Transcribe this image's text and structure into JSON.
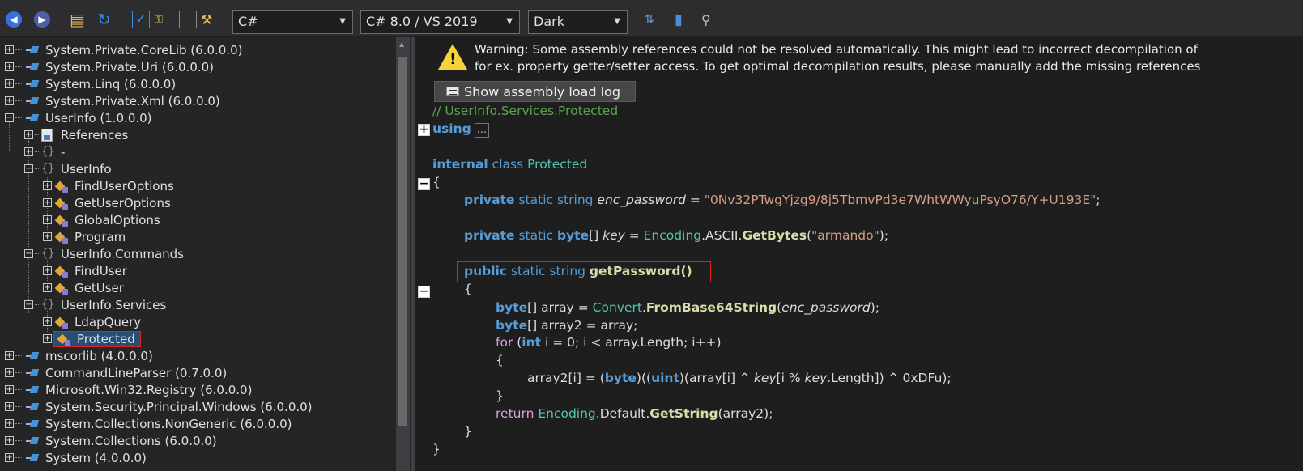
{
  "toolbar": {
    "language": "C#",
    "language_version": "C# 8.0 / VS 2019",
    "theme": "Dark"
  },
  "tree": {
    "items": [
      {
        "label": "System.Private.CoreLib (6.0.0.0)"
      },
      {
        "label": "System.Private.Uri (6.0.0.0)"
      },
      {
        "label": "System.Linq (6.0.0.0)"
      },
      {
        "label": "System.Private.Xml (6.0.0.0)"
      },
      {
        "label": "UserInfo (1.0.0.0)"
      },
      {
        "label": "References"
      },
      {
        "label": "-"
      },
      {
        "label": "UserInfo"
      },
      {
        "label": "FindUserOptions"
      },
      {
        "label": "GetUserOptions"
      },
      {
        "label": "GlobalOptions"
      },
      {
        "label": "Program"
      },
      {
        "label": "UserInfo.Commands"
      },
      {
        "label": "FindUser"
      },
      {
        "label": "GetUser"
      },
      {
        "label": "UserInfo.Services"
      },
      {
        "label": "LdapQuery"
      },
      {
        "label": "Protected"
      },
      {
        "label": "mscorlib (4.0.0.0)"
      },
      {
        "label": "CommandLineParser (0.7.0.0)"
      },
      {
        "label": "Microsoft.Win32.Registry (6.0.0.0)"
      },
      {
        "label": "System.Security.Principal.Windows (6.0.0.0)"
      },
      {
        "label": "System.Collections.NonGeneric (6.0.0.0)"
      },
      {
        "label": "System.Collections (6.0.0.0)"
      },
      {
        "label": "System (4.0.0.0)"
      }
    ]
  },
  "warning": {
    "line1": "Warning: Some assembly references could not be resolved automatically. This might lead to incorrect decompilation of",
    "line2": "for ex. property getter/setter access. To get optimal decompilation results, please manually add the missing references",
    "button": "Show assembly load log"
  },
  "code": {
    "comment": "// UserInfo.Services.Protected",
    "using": "using",
    "using_ellipsis": "...",
    "class_decl_kw": "internal",
    "class_decl_class": "class",
    "class_name": "Protected",
    "open_brace": "{",
    "close_brace": "}",
    "enc_password_value": "\"0Nv32PTwgYjzg9/8j5TbmvPd3e7WhtWWyuPsyO76/Y+U193E\"",
    "key_value": "\"armando\"",
    "method_name": "getPassword",
    "hex_const": "0xDFu"
  }
}
